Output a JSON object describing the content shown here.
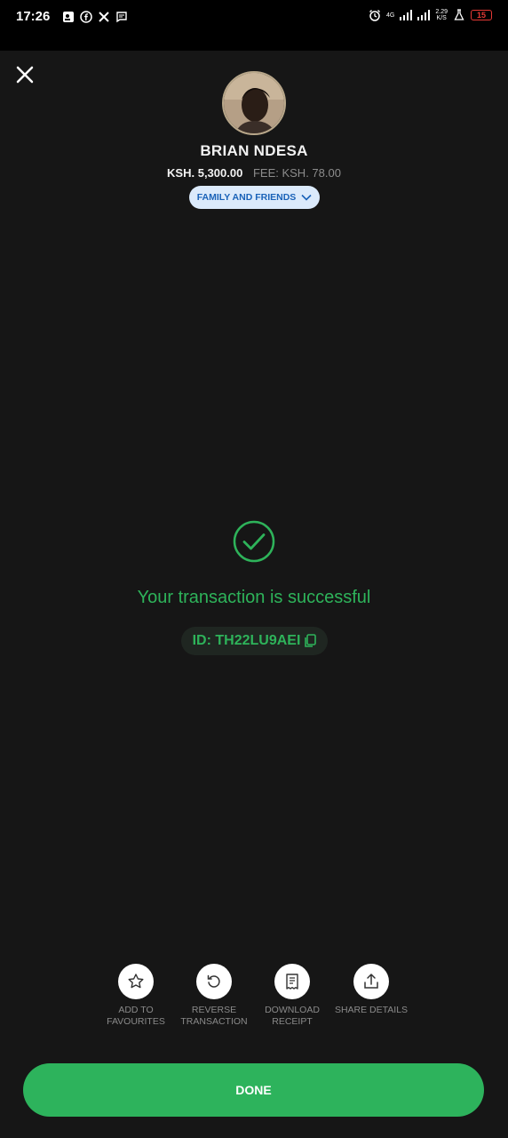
{
  "status_bar": {
    "time": "17:26",
    "network_top": "4G",
    "speed_value": "2.29",
    "speed_unit": "K/S",
    "battery": "15"
  },
  "recipient": {
    "name": "BRIAN NDESA",
    "amount": "KSH. 5,300.00",
    "fee": "FEE: KSH. 78.00",
    "category": "FAMILY AND FRIENDS"
  },
  "result": {
    "message": "Your transaction is successful",
    "transaction_id": "ID: TH22LU9AEI"
  },
  "actions": [
    {
      "label": "ADD TO\nFAVOURITES",
      "icon": "star-icon"
    },
    {
      "label": "REVERSE\nTRANSACTION",
      "icon": "reverse-icon"
    },
    {
      "label": "DOWNLOAD\nRECEIPT",
      "icon": "receipt-icon"
    },
    {
      "label": "SHARE DETAILS",
      "icon": "share-icon"
    }
  ],
  "done_label": "DONE",
  "colors": {
    "background": "#161616",
    "success_green": "#2eb35a",
    "pill_bg": "#dbeafb",
    "pill_text": "#1a62b8"
  }
}
